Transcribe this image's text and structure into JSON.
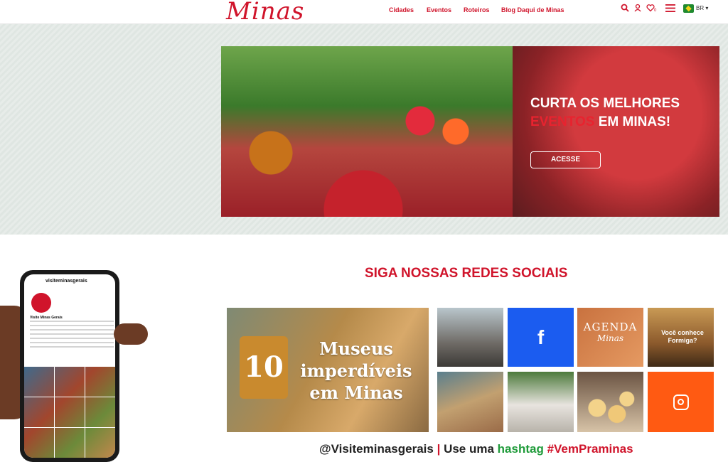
{
  "header": {
    "logo_text": "Minas",
    "nav": [
      "Cidades",
      "Eventos",
      "Roteiros",
      "Blog Daqui de Minas"
    ],
    "lang": "BR",
    "favorites_count": "0",
    "icons": [
      "search-icon",
      "user-icon",
      "heart-icon",
      "menu-icon",
      "flag-icon"
    ]
  },
  "banner": {
    "line1": "CURTA OS MELHORES",
    "line2_red": "EVENTOS",
    "line2_rest": " EM MINAS!",
    "button": "ACESSE"
  },
  "social": {
    "title": "SIGA NOSSAS REDES SOCIAIS",
    "phone_handle": "visiteminasgerais",
    "phone_name": "Visite Minas Gerais",
    "museus_num": "10",
    "museus_caption": "Museus imperdíveis em Minas",
    "agenda_1": "AGENDA",
    "agenda_2": "Minas",
    "forminga_text": "Você conhece Formiga?",
    "fb_glyph": "f"
  },
  "footer_line": {
    "handle": "@Visiteminasgerais",
    "sep": " | ",
    "use": "Use uma ",
    "hashtag_word": "hashtag",
    "tag": " #VemPraminas"
  },
  "colors": {
    "brand_red": "#d0142b",
    "facebook_blue": "#1b5cf0",
    "instagram_orange": "#ff5a12",
    "hashtag_green": "#1f9b3a"
  }
}
